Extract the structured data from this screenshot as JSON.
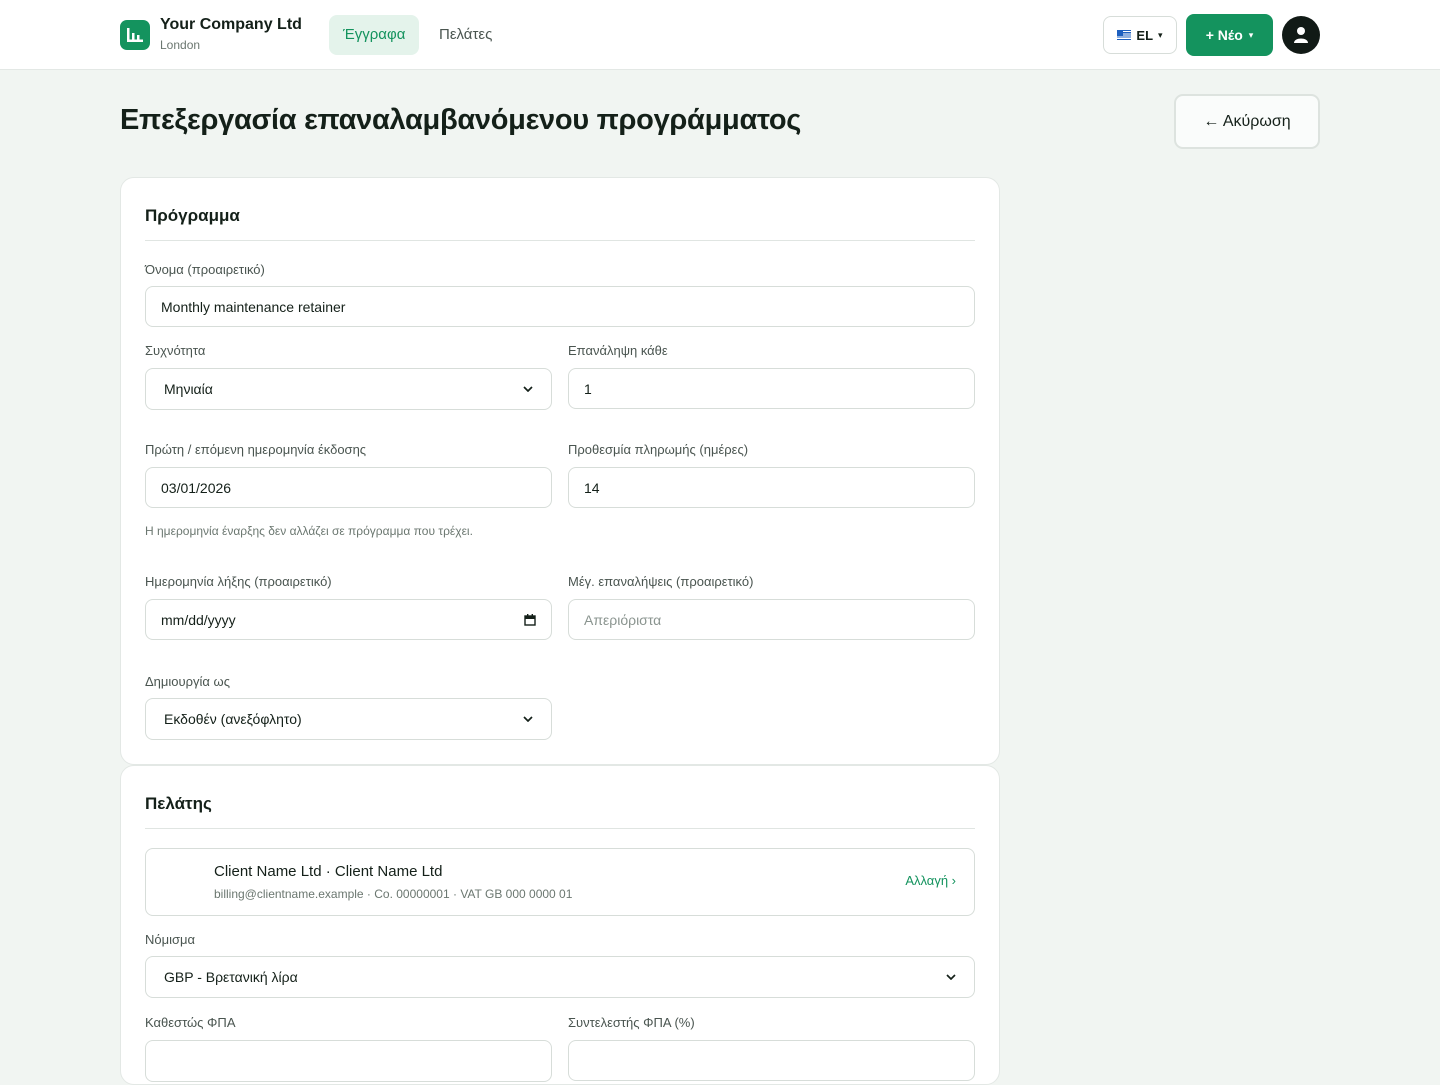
{
  "header": {
    "company_name": "Your Company Ltd",
    "company_city": "London",
    "nav": [
      {
        "label": "Έγγραφα",
        "active": true
      },
      {
        "label": "Πελάτες",
        "active": false
      }
    ],
    "language": "EL",
    "new_button": "+ Νέο",
    "caret": "▾"
  },
  "page": {
    "title": "Επεξεργασία επαναλαμβανόμενου προγράμματος",
    "cancel_label": "← Ακύρωση"
  },
  "program": {
    "section_title": "Πρόγραμμα",
    "name": {
      "label": "Όνομα (προαιρετικό)",
      "value": "Monthly maintenance retainer"
    },
    "frequency": {
      "label": "Συχνότητα",
      "value": "Μηνιαία"
    },
    "repeat_every": {
      "label": "Επανάληψη κάθε",
      "value": "1"
    },
    "first_issue_date": {
      "label": "Πρώτη / επόμενη ημερομηνία έκδοσης",
      "value": "03/01/2026"
    },
    "payment_terms": {
      "label": "Προθεσμία πληρωμής (ημέρες)",
      "value": "14"
    },
    "start_date_hint": "Η ημερομηνία έναρξης δεν αλλάζει σε πρόγραμμα που τρέχει.",
    "end_date": {
      "label": "Ημερομηνία λήξης (προαιρετικό)",
      "placeholder": "mm/dd/yyyy"
    },
    "max_repeats": {
      "label": "Μέγ. επαναλήψεις (προαιρετικό)",
      "placeholder": "Απεριόριστα"
    },
    "create_as": {
      "label": "Δημιουργία ως",
      "value": "Εκδοθέν (ανεξόφλητο)"
    }
  },
  "client": {
    "section_title": "Πελάτης",
    "name": "Client Name Ltd · Client Name Ltd",
    "meta": "billing@clientname.example · Co. 00000001 · VAT GB 000 0000 01",
    "change_label": "Αλλαγή ›",
    "currency": {
      "label": "Νόμισμα",
      "value": "GBP - Βρετανική λίρα"
    },
    "vat_status": {
      "label": "Καθεστώς ΦΠΑ"
    },
    "vat_rate": {
      "label": "Συντελεστής ΦΠΑ (%)"
    }
  },
  "colors": {
    "accent": "#14935e",
    "accent_light": "#e4f3eb",
    "background": "#f1f5f2"
  },
  "icons": [
    "logo-chart-icon",
    "flag-icon",
    "user-icon",
    "chevron-down-icon",
    "calendar-icon"
  ]
}
